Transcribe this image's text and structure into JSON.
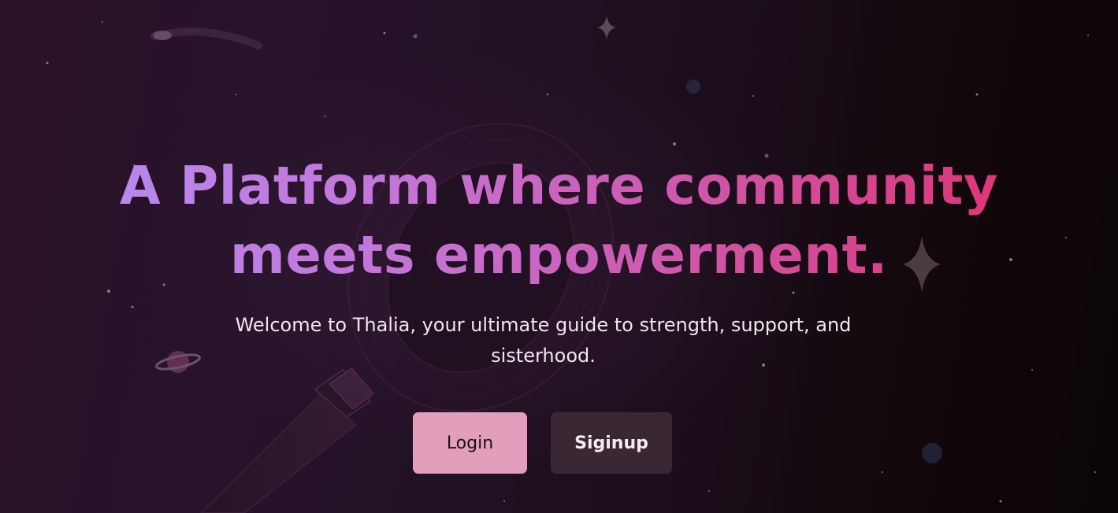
{
  "hero": {
    "headline_line1": "A Platform where community",
    "headline_line2": "meets empowerment.",
    "subtitle": "Welcome to Thalia, your ultimate guide to strength, support, and sisterhood."
  },
  "actions": {
    "login_label": "Login",
    "signup_label": "Siginup"
  },
  "colors": {
    "headline_gradient": [
      "#b58cf2",
      "#c474d6",
      "#d24f9d",
      "#e02f6f"
    ],
    "login_bg": "#e29fbc",
    "signup_bg": "#3a2734",
    "background_dark": "#0b0506",
    "background_plum": "#2c1228"
  },
  "decorations": [
    "sparkle-icon",
    "planet-icon",
    "telescope-illustration",
    "shooting-star",
    "stars"
  ]
}
